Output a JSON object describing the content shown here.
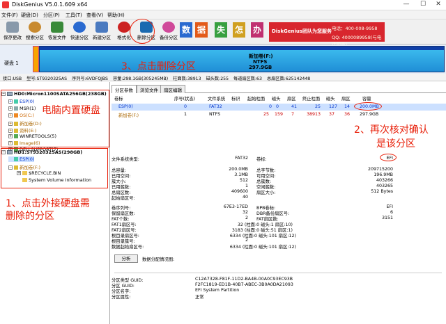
{
  "window": {
    "title": "DiskGenius V5.0.1.609 x64",
    "controls": [
      "—",
      "☐",
      "✕"
    ]
  },
  "menu": [
    "文件(F)",
    "硬盘(D)",
    "分区(P)",
    "工具(T)",
    "查看(V)",
    "帮助(H)"
  ],
  "toolbar": [
    {
      "label": "保存更改",
      "icon": "save-icon",
      "color": "#8899aa"
    },
    {
      "label": "搜索分区",
      "icon": "search-icon",
      "color": "#c88a30"
    },
    {
      "label": "恢复文件",
      "icon": "recover-icon",
      "color": "#3a8a3a"
    },
    {
      "label": "快速分区",
      "icon": "quick-partition-icon",
      "color": "#2a6ad0"
    },
    {
      "label": "新建分区",
      "icon": "new-partition-icon",
      "color": "#4a7ac0"
    },
    {
      "label": "格式化",
      "icon": "format-icon",
      "color": "#cc2222"
    },
    {
      "label": "删除分区",
      "icon": "trash-icon",
      "color": "#1a6ab0"
    },
    {
      "label": "备份分区",
      "icon": "backup-icon",
      "color": "#d04a9a"
    }
  ],
  "banner": {
    "chars": [
      "数",
      "据",
      "失",
      "怎",
      "办"
    ],
    "brand": "DiskGenius团队为您服务",
    "phone": "电话：400-008-9958",
    "qq": "QQ: 4000089958(与电话同号)"
  },
  "diskmap": {
    "label": "硬盘 1",
    "name": "新加卷(F:)",
    "fs": "NTFS",
    "size": "297.9GB"
  },
  "infoline": [
    "接口:USB",
    "型号:ST9320325AS",
    "序列号:6VDFQJBS",
    "容量:298.1GB(305245MB)",
    "柱面数:38913",
    "磁头数:255",
    "每道扇区数:63",
    "总扇区数:625142448"
  ],
  "tree": {
    "hd0": "HD0:Micron1100SATA256GB(238GB)",
    "hd0_parts": [
      "ESP(0)",
      "MSR(1)",
      "OS(C:)",
      "新加卷(D:)",
      "资料(E:)",
      "WINRETOOLS(5)",
      "Image(6)",
      "DELLSUPPORT(7)"
    ],
    "hd1": "HD1:ST9320325AS(298GB)",
    "hd1_parts": [
      "ESP(0)",
      "新加卷(F:)"
    ],
    "hd1_files": [
      "$RECYCLE.BIN",
      "System Volume Information"
    ]
  },
  "tabs": [
    "分区参数",
    "浏览文件",
    "扇区编辑"
  ],
  "table": {
    "headers": [
      "卷标",
      "序号(状态)",
      "文件系统",
      "标识",
      "起始柱面",
      "磁头",
      "扇区",
      "终止柱面",
      "磁头",
      "扇区",
      "容量"
    ],
    "rows": [
      {
        "name": "ESP(0)",
        "seq": "0",
        "fs": "FAT32",
        "flag": "",
        "sc": "0",
        "sh": "0",
        "ss": "41",
        "ec": "25",
        "eh": "127",
        "es": "14",
        "cap": "200.0MB"
      },
      {
        "name": "新加卷(F:)",
        "seq": "1",
        "fs": "NTFS",
        "flag": "",
        "sc": "25",
        "sh": "159",
        "ss": "7",
        "ec": "38913",
        "eh": "37",
        "es": "36",
        "cap": "297.9GB"
      }
    ]
  },
  "details": {
    "fs_type_label": "文件系统类型:",
    "fs_type": "FAT32",
    "vol_label_label": "卷标:",
    "vol_label": "EFI",
    "left": [
      [
        "总容量:",
        "200.0MB"
      ],
      [
        "已用空间:",
        "3.1MB"
      ],
      [
        "簇大小:",
        "512"
      ],
      [
        "已用簇数:",
        "1"
      ],
      [
        "总扇区数:",
        "409600"
      ],
      [
        "起始扇区号:",
        "40"
      ]
    ],
    "right": [
      [
        "总字节数:",
        "209715200"
      ],
      [
        "可用空间:",
        "196.9MB"
      ],
      [
        "总簇数:",
        "403266"
      ],
      [
        "空闲簇数:",
        "403265"
      ],
      [
        "扇区大小:",
        "512 Bytes"
      ]
    ],
    "left2": [
      [
        "卷序列号:",
        "67E3-17ED"
      ],
      [
        "保留扇区数:",
        "32"
      ],
      [
        "FAT个数:",
        "2"
      ],
      [
        "FAT1扇区号:",
        "32 (柱面:0 磁头:1 扇区:10)"
      ],
      [
        "FAT2扇区号:",
        "3183 (柱面:0 磁头:51 扇区:1)"
      ],
      [
        "根目录扇区号:",
        "6334 (柱面:0 磁头:101 扇区:12)"
      ],
      [
        "根目录簇号:",
        "2"
      ],
      [
        "数据起始扇区号:",
        "6334 (柱面:0 磁头:101 扇区:12)"
      ]
    ],
    "right2": [
      [
        "BPB卷标:",
        "EFI"
      ],
      [
        "DBR备份扇区号:",
        "6"
      ],
      [
        "FAT扇区数:",
        "3151"
      ]
    ],
    "analyze_button": "分析",
    "analyze_label": "数据分配情况图:",
    "guid": [
      [
        "分区类型 GUID:",
        "C12A7328-F81F-11D2-BA4B-00A0C93EC93B"
      ],
      [
        "分区 GUID:",
        "F2FC1819-ED1B-40B7-ABEC-3B0A0DA21093"
      ],
      [
        "分区名字:",
        "EFI System Partition"
      ],
      [
        "分区属性:",
        "正常"
      ]
    ]
  },
  "annotations": {
    "a1": "1、点击外接硬盘需",
    "a1b": "删除的分区",
    "a2": "2、再次核对确认",
    "a2b": "是该分区",
    "a3": "3、点击删除分区",
    "builtin": "电脑内置硬盘"
  }
}
